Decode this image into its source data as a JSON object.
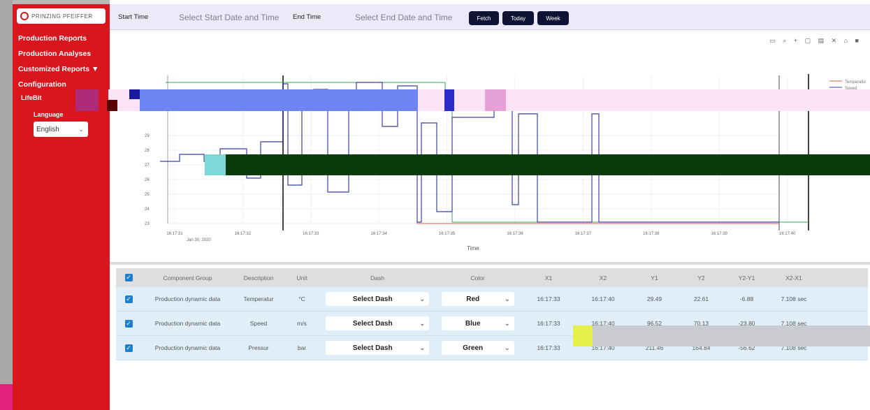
{
  "brand": {
    "logo_text": "PRINZING PFEIFFER"
  },
  "sidebar": {
    "items": [
      {
        "label": "Production Reports"
      },
      {
        "label": "Production Analyses"
      },
      {
        "label": "Customized Reports ▼"
      },
      {
        "label": "Configuration"
      }
    ],
    "sub_item": "LifeBit",
    "language_label": "Language",
    "language_value": "English"
  },
  "toolbar": {
    "start_label": "Start Time",
    "start_placeholder": "Select Start Date and Time",
    "end_label": "End Time",
    "end_placeholder": "Select End Date and Time",
    "fetch": "Fetch",
    "today": "Today",
    "week": "Week"
  },
  "chart_data": {
    "type": "line",
    "xlabel": "Time",
    "x_ticks": [
      "16:17:31",
      "16:17:32",
      "16:17:33",
      "16:17:34",
      "16:17:35",
      "16:17:36",
      "16:17:37",
      "16:17:38",
      "16:17:39",
      "16:17:40"
    ],
    "x_date": "Jan 30, 2020",
    "y_ticks": [
      23,
      24,
      25,
      26,
      27,
      28,
      29
    ],
    "legend": [
      "Temperatur",
      "Speed"
    ],
    "series": [
      {
        "name": "Temperatur",
        "color": "#e05a3a"
      },
      {
        "name": "Speed",
        "color": "#3b3f9e"
      },
      {
        "name": "Pressur",
        "color": "#3aa655"
      }
    ]
  },
  "table": {
    "headers": [
      "Component Group",
      "Description",
      "Unit",
      "Dash",
      "Color",
      "X1",
      "X2",
      "Y1",
      "Y2",
      "Y2-Y1",
      "X2-X1"
    ],
    "rows": [
      {
        "group": "Production dynamic data",
        "desc": "Temperatur",
        "unit": "°C",
        "dash": "Select Dash",
        "color": "Red",
        "x1": "16:17:33",
        "x2": "16:17:40",
        "y1": "29.49",
        "y2": "22.61",
        "dy": "-6.88",
        "dx": "7.108 sec"
      },
      {
        "group": "Production dynamic data",
        "desc": "Speed",
        "unit": "m/s",
        "dash": "Select Dash",
        "color": "Blue",
        "x1": "16:17:33",
        "x2": "16:17:40",
        "y1": "96.52",
        "y2": "70.13",
        "dy": "-23.80",
        "dx": "7.108 sec"
      },
      {
        "group": "Production dynamic data",
        "desc": "Pressur",
        "unit": "bar",
        "dash": "Select Dash",
        "color": "Green",
        "x1": "16:17:33",
        "x2": "16:17:40",
        "y1": "211.46",
        "y2": "164.84",
        "dy": "-56.62",
        "dx": "7.108 sec"
      }
    ]
  }
}
